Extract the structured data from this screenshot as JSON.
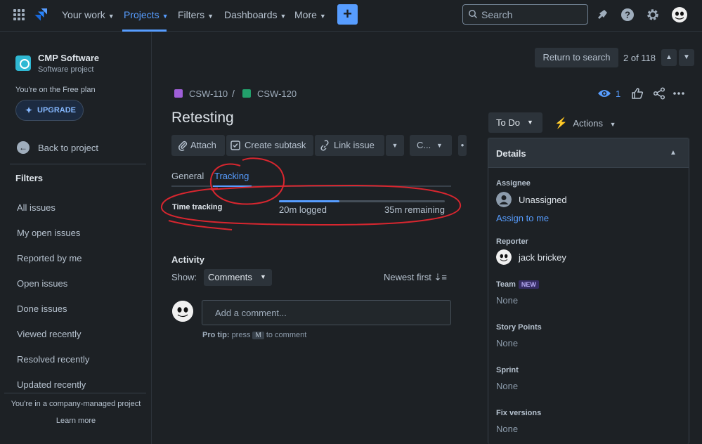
{
  "nav": {
    "items": [
      {
        "label": "Your work"
      },
      {
        "label": "Projects"
      },
      {
        "label": "Filters"
      },
      {
        "label": "Dashboards"
      },
      {
        "label": "More"
      }
    ],
    "search_placeholder": "Search",
    "accent": "#579dff"
  },
  "sidebar": {
    "project_name": "CMP Software",
    "project_type": "Software project",
    "plan_note": "You're on the Free plan",
    "upgrade_label": "UPGRADE",
    "back_label": "Back to project",
    "filters_heading": "Filters",
    "filters": [
      "All issues",
      "My open issues",
      "Reported by me",
      "Open issues",
      "Done issues",
      "Viewed recently",
      "Resolved recently",
      "Updated recently"
    ],
    "company_note": "You're in a company-managed project",
    "learn_more": "Learn more"
  },
  "issue": {
    "return_label": "Return to search",
    "pager": "2 of 118",
    "parent_key": "CSW-110",
    "key": "CSW-120",
    "separator": "/",
    "title": "Retesting",
    "toolbar": {
      "attach": "Attach",
      "create_subtask": "Create subtask",
      "link_issue": "Link issue",
      "more_short": "C..."
    },
    "tabs": {
      "general": "General",
      "tracking": "Tracking"
    },
    "time_tracking": {
      "label": "Time tracking",
      "logged": "20m logged",
      "remaining": "35m remaining",
      "progress_fraction": 0.364
    },
    "activity": {
      "heading": "Activity",
      "show_label": "Show:",
      "show_value": "Comments",
      "sort_label": "Newest first",
      "comment_placeholder": "Add a comment...",
      "protip_bold": "Pro tip:",
      "protip_press": "press",
      "protip_key": "M",
      "protip_rest": "to comment"
    }
  },
  "right": {
    "watchers": "1",
    "status": "To Do",
    "actions_label": "Actions",
    "details_heading": "Details",
    "assignee_label": "Assignee",
    "assignee_value": "Unassigned",
    "assign_me": "Assign to me",
    "reporter_label": "Reporter",
    "reporter_value": "jack brickey",
    "team_label": "Team",
    "team_badge": "NEW",
    "team_value": "None",
    "story_points_label": "Story Points",
    "story_points_value": "None",
    "sprint_label": "Sprint",
    "sprint_value": "None",
    "fix_versions_label": "Fix versions",
    "fix_versions_value": "None"
  }
}
